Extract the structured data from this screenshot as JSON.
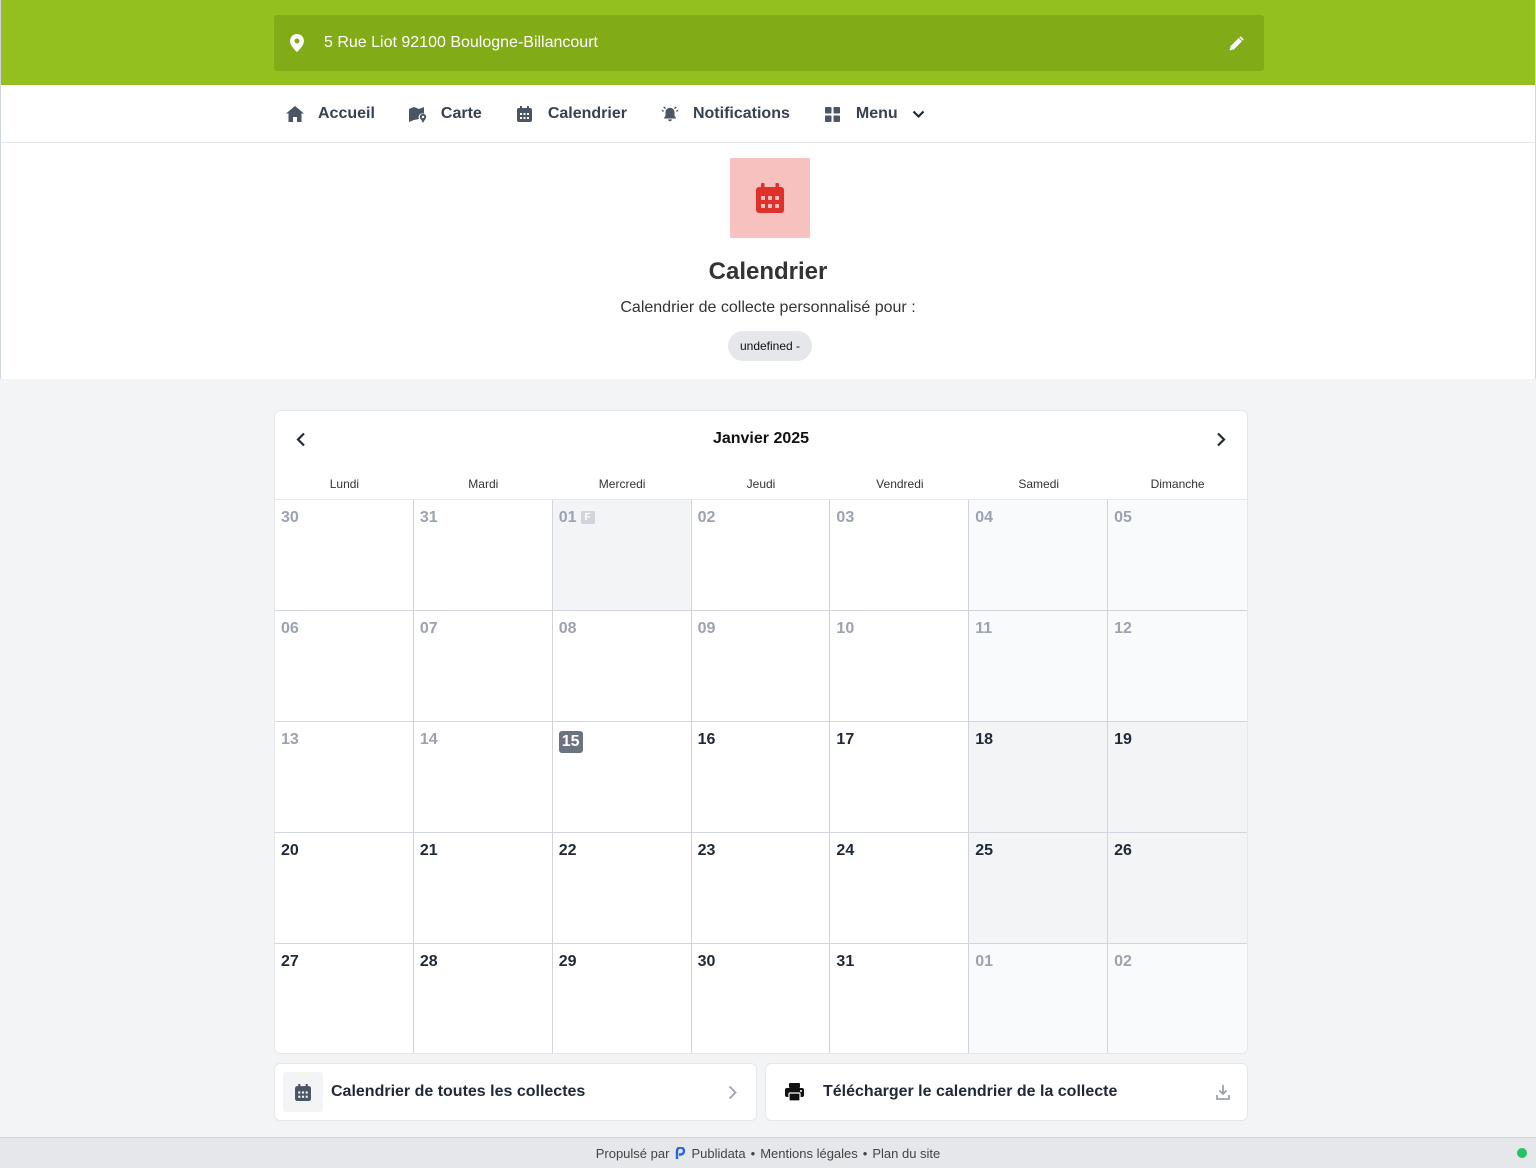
{
  "header": {
    "address": "5 Rue Liot 92100 Boulogne-Billancourt"
  },
  "nav": {
    "items": [
      {
        "label": "Accueil",
        "icon": "home-icon"
      },
      {
        "label": "Carte",
        "icon": "map-icon"
      },
      {
        "label": "Calendrier",
        "icon": "calendar-icon"
      },
      {
        "label": "Notifications",
        "icon": "bell-icon"
      },
      {
        "label": "Menu",
        "icon": "grid-icon"
      }
    ]
  },
  "hero": {
    "title": "Calendrier",
    "subtitle": "Calendrier de collecte personnalisé pour :",
    "chip": "undefined -",
    "icon_color": "#e0302a",
    "icon_bg": "#f6c1be"
  },
  "calendar": {
    "month": "Janvier 2025",
    "weekdays": [
      "Lundi",
      "Mardi",
      "Mercredi",
      "Jeudi",
      "Vendredi",
      "Samedi",
      "Dimanche"
    ],
    "holiday_badge": "F",
    "days": [
      [
        "30",
        "31",
        "01",
        "02",
        "03",
        "04",
        "05"
      ],
      [
        "06",
        "07",
        "08",
        "09",
        "10",
        "11",
        "12"
      ],
      [
        "13",
        "14",
        "15",
        "16",
        "17",
        "18",
        "19"
      ],
      [
        "20",
        "21",
        "22",
        "23",
        "24",
        "25",
        "26"
      ],
      [
        "27",
        "28",
        "29",
        "30",
        "31",
        "01",
        "02"
      ]
    ]
  },
  "actions": {
    "all_collections": "Calendrier de toutes les collectes",
    "download": "Télécharger le calendrier de la collecte"
  },
  "footer": {
    "powered_by": "Propulsé par",
    "brand": "Publidata",
    "legal": "Mentions légales",
    "sitemap": "Plan du site"
  },
  "colors": {
    "brand_green": "#93c01f",
    "address_green": "#82ab18",
    "status_green": "#22c55e"
  }
}
